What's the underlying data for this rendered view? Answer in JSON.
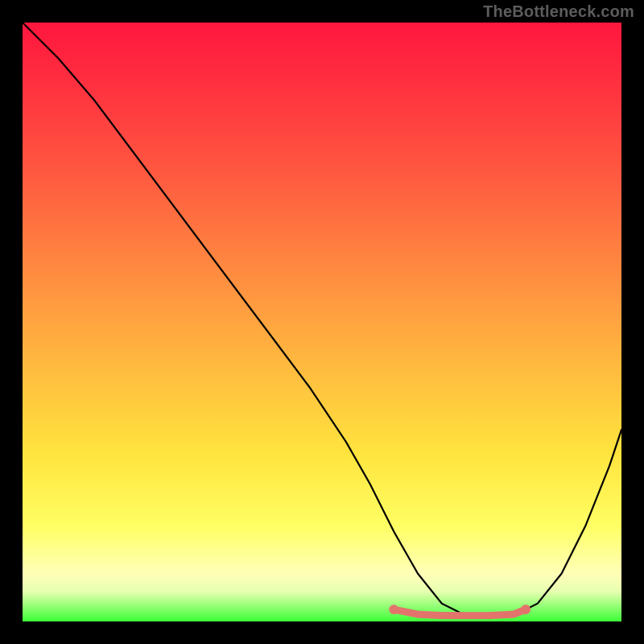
{
  "watermark": "TheBottleneck.com",
  "colors": {
    "gradient_top": "#ff163e",
    "gradient_mid1": "#ff8640",
    "gradient_mid2": "#ffe43e",
    "gradient_bottom": "#3cff37",
    "curve": "#000000",
    "highlight": "#e2746c",
    "background": "#000000"
  },
  "chart_data": {
    "type": "line",
    "title": "",
    "xlabel": "",
    "ylabel": "",
    "xlim": [
      0,
      100
    ],
    "ylim": [
      0,
      100
    ],
    "grid": false,
    "legend": false,
    "series": [
      {
        "name": "bottleneck-curve",
        "x": [
          0,
          6,
          12,
          18,
          24,
          30,
          36,
          42,
          48,
          54,
          58,
          62,
          66,
          70,
          74,
          78,
          82,
          86,
          90,
          94,
          98,
          100
        ],
        "y": [
          100,
          94,
          87,
          79,
          71,
          63,
          55,
          47,
          39,
          30,
          23,
          15,
          8,
          3,
          1,
          1,
          1,
          3,
          8,
          16,
          26,
          32
        ]
      },
      {
        "name": "optimal-range-highlight",
        "x": [
          62,
          66,
          70,
          74,
          78,
          82,
          84
        ],
        "y": [
          2.0,
          1.2,
          1.0,
          1.0,
          1.0,
          1.2,
          2.0
        ]
      }
    ],
    "annotations": []
  }
}
